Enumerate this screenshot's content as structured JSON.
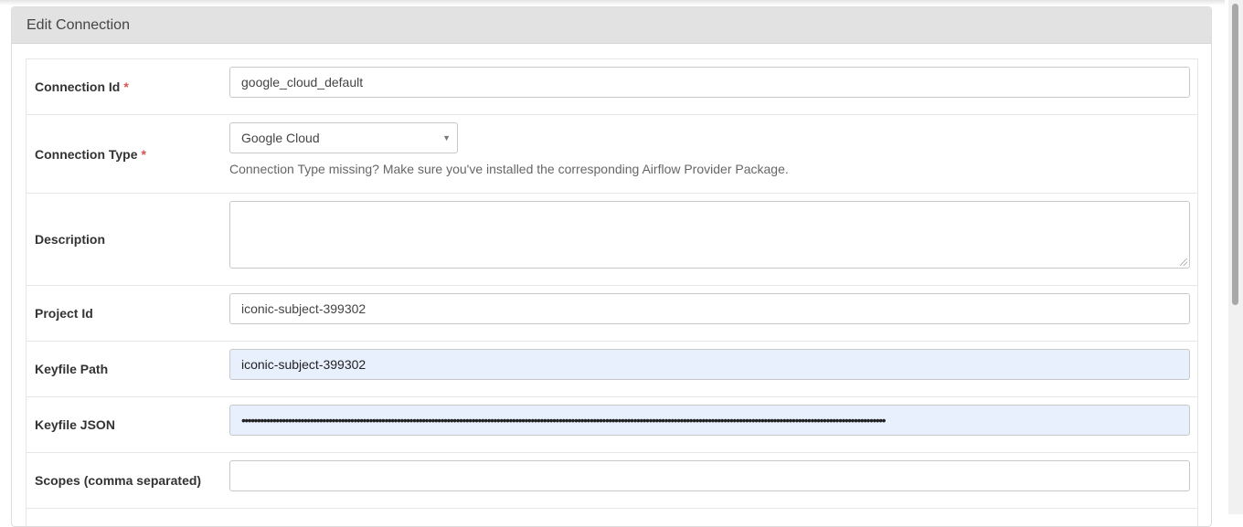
{
  "panel": {
    "title": "Edit Connection"
  },
  "fields": {
    "connection_id": {
      "label": "Connection Id",
      "required_mark": "*",
      "value": "google_cloud_default"
    },
    "connection_type": {
      "label": "Connection Type",
      "required_mark": "*",
      "value": "Google Cloud",
      "help": "Connection Type missing? Make sure you've installed the corresponding Airflow Provider Package."
    },
    "description": {
      "label": "Description",
      "value": ""
    },
    "project_id": {
      "label": "Project Id",
      "value": "iconic-subject-399302"
    },
    "keyfile_path": {
      "label": "Keyfile Path",
      "value": "iconic-subject-399302"
    },
    "keyfile_json": {
      "label": "Keyfile JSON",
      "value": "•••••••••••••••••••••••••••••••••••••••••••••••••••••••••••••••••••••••••••••••••••••••••••••••••••••••••••••••••••••••••••••••••••••••••••••••••••••••••••••••••••••••••••••••••••••••••••••••••••••••••••••••"
    },
    "scopes": {
      "label": "Scopes (comma separated)",
      "value": ""
    }
  },
  "colors": {
    "required": "#d9534f",
    "autofill_bg": "#e8f0fe",
    "header_bg": "#e2e2e2"
  },
  "icons": {
    "select_caret": "caret-down-icon"
  }
}
